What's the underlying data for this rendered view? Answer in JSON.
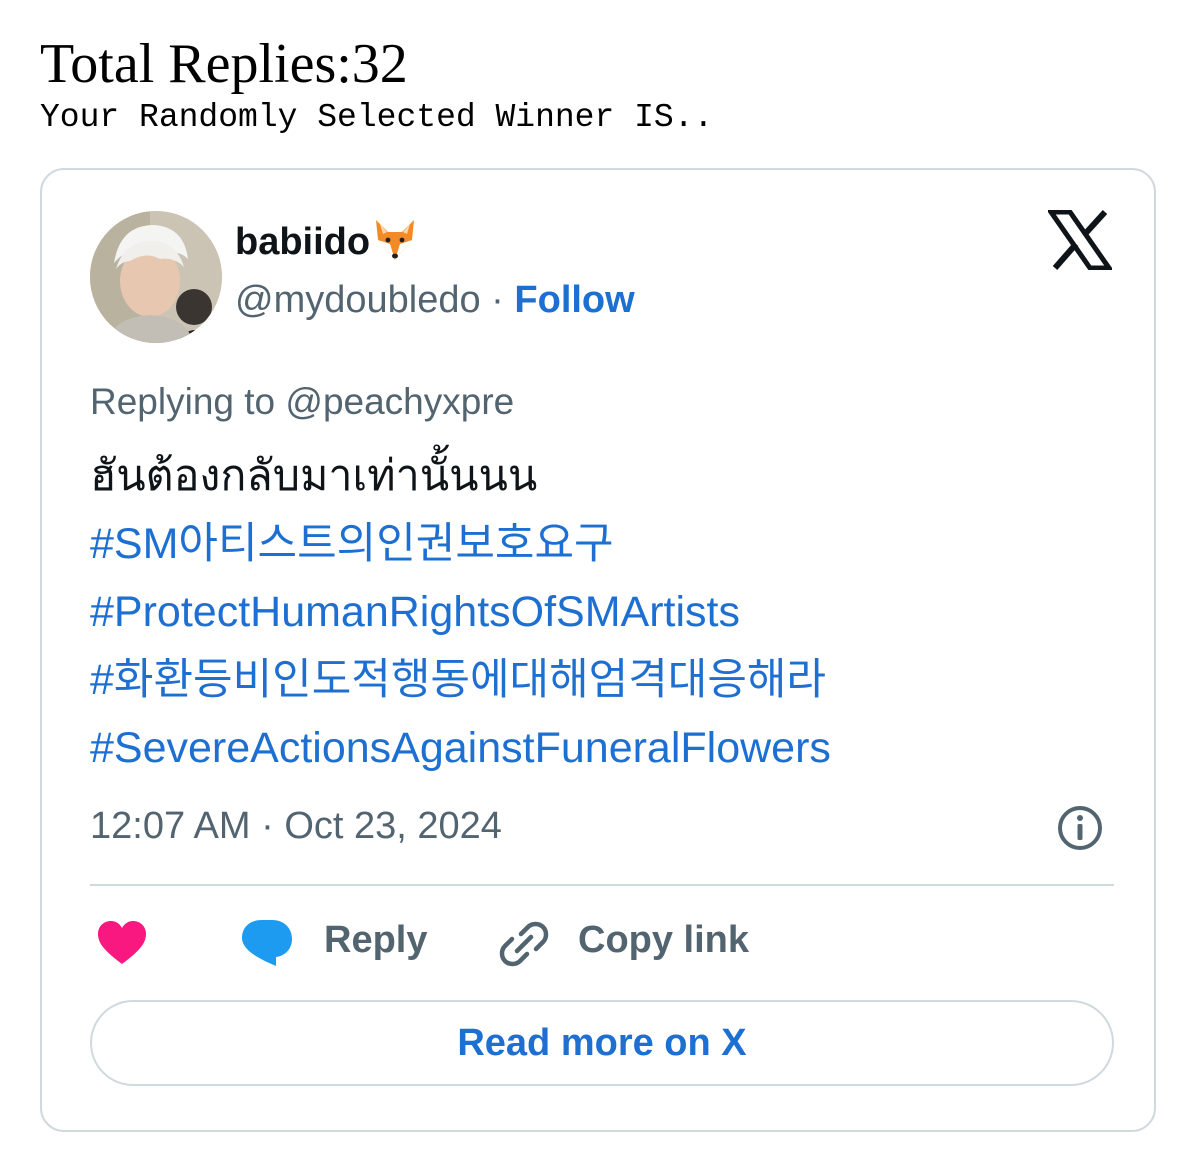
{
  "header": {
    "title": "Total Replies:32",
    "subtitle": "Your Randomly Selected Winner IS.."
  },
  "tweet": {
    "display_name": "babiido",
    "name_emoji": "fox-face-icon",
    "handle": "@mydoubledo",
    "separator": " · ",
    "follow_label": "Follow",
    "replying_to": "Replying to @peachyxpre",
    "text_line": "ฮันต้องกลับมาเท่านั้นนน",
    "hashtags": [
      "#SM아티스트의인권보호요구",
      "#ProtectHumanRightsOfSMArtists",
      "#화환등비인도적행동에대해엄격대응해라",
      "#SevereActionsAgainstFuneralFlowers"
    ],
    "timestamp": "12:07 AM · Oct 23, 2024",
    "platform_logo": "x-logo-icon"
  },
  "actions": {
    "like_icon": "heart-icon",
    "reply_label": "Reply",
    "copy_label": "Copy link"
  },
  "read_more_label": "Read more on X",
  "colors": {
    "link_blue": "#1d6fd1",
    "secondary_text": "#536471",
    "border": "#cfd9de",
    "heart": "#f91880",
    "reply_bubble": "#1d9bf0"
  }
}
